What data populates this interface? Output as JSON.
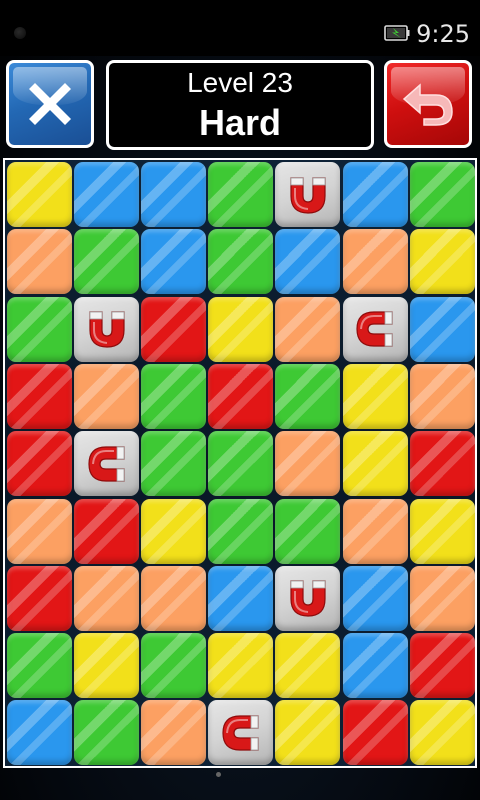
{
  "status_bar": {
    "time": "9:25",
    "battery_icon": "battery-charging-icon"
  },
  "header": {
    "close_icon": "close-icon",
    "undo_icon": "undo-arrow-icon",
    "level_title": "Level 23",
    "difficulty": "Hard"
  },
  "colors": {
    "yellow": "#f2e01a",
    "blue": "#2a97ee",
    "green": "#3ec934",
    "orange": "#fca062",
    "red": "#e21616",
    "magnet": "#d3d3d3",
    "close_button": "#2368b4",
    "undo_button": "#cf0f0f"
  },
  "board": {
    "rows": 9,
    "cols": 7,
    "grid": [
      [
        "yellow",
        "blue",
        "blue",
        "green",
        "magnet-up",
        "blue",
        "green"
      ],
      [
        "orange",
        "green",
        "blue",
        "green",
        "blue",
        "orange",
        "yellow"
      ],
      [
        "green",
        "magnet-up",
        "red",
        "yellow",
        "orange",
        "magnet-left",
        "blue"
      ],
      [
        "red",
        "orange",
        "green",
        "red",
        "green",
        "yellow",
        "orange"
      ],
      [
        "red",
        "magnet-left",
        "green",
        "green",
        "orange",
        "yellow",
        "red"
      ],
      [
        "orange",
        "red",
        "yellow",
        "green",
        "green",
        "orange",
        "yellow"
      ],
      [
        "red",
        "orange",
        "orange",
        "blue",
        "magnet-up",
        "blue",
        "orange"
      ],
      [
        "green",
        "yellow",
        "green",
        "yellow",
        "yellow",
        "blue",
        "red"
      ],
      [
        "blue",
        "green",
        "orange",
        "magnet-left",
        "yellow",
        "red",
        "yellow"
      ]
    ]
  }
}
